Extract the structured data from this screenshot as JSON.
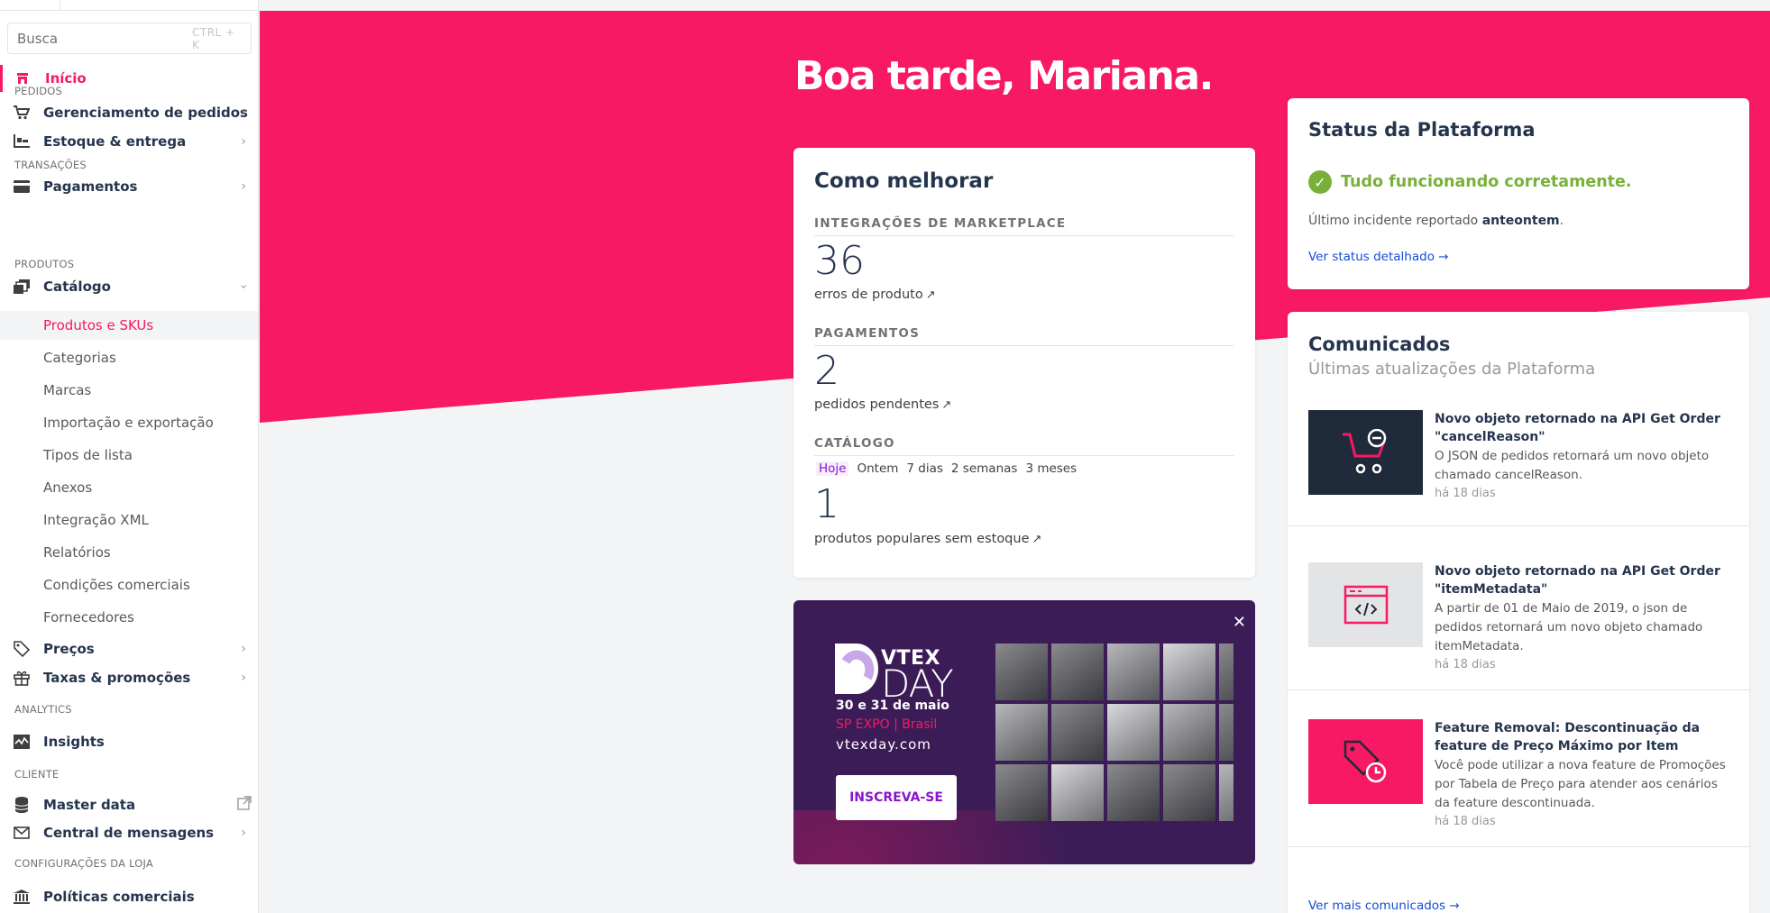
{
  "sidebar": {
    "search": {
      "placeholder": "Busca",
      "shortcut": "CTRL + K"
    },
    "home": "Início",
    "sections": {
      "pedidos": "PEDIDOS",
      "transacoes": "TRANSAÇÕES",
      "produtos": "PRODUTOS",
      "analytics": "ANALYTICS",
      "cliente": "CLIENTE",
      "config": "CONFIGURAÇÕES DA LOJA"
    },
    "items": {
      "gerenciamento": "Gerenciamento de pedidos",
      "estoque": "Estoque & entrega",
      "pagamentos": "Pagamentos",
      "catalogo": "Catálogo",
      "precos": "Preços",
      "taxas": "Taxas & promoções",
      "insights": "Insights",
      "masterdata": "Master data",
      "central": "Central de mensagens",
      "politicas": "Políticas comerciais"
    },
    "catalog_sub": [
      "Produtos e SKUs",
      "Categorias",
      "Marcas",
      "Importação e exportação",
      "Tipos de lista",
      "Anexos",
      "Integração XML",
      "Relatórios",
      "Condições comerciais",
      "Fornecedores"
    ]
  },
  "greeting": {
    "prefix": "Boa tarde,",
    "name": "Mariana",
    "suffix": "."
  },
  "como_melhorar": {
    "title": "Como melhorar",
    "marketplace": {
      "label": "INTEGRAÇÕES DE MARKETPLACE",
      "value": "36",
      "desc": "erros de produto"
    },
    "pagamentos": {
      "label": "PAGAMENTOS",
      "value": "2",
      "desc": "pedidos pendentes"
    },
    "catalogo": {
      "label": "CATÁLOGO",
      "periods": [
        "Hoje",
        "Ontem",
        "7 dias",
        "2 semanas",
        "3 meses"
      ],
      "value": "1",
      "desc": "produtos populares sem estoque"
    },
    "arrow": "↗"
  },
  "promo": {
    "close": "✕",
    "brand": "VTEX",
    "event": "DAY",
    "dates": "30 e 31 de maio",
    "place": "SP EXPO | Brasil",
    "site": "vtexday.com",
    "cta": "INSCREVA-SE"
  },
  "status": {
    "title": "Status da Plataforma",
    "ok": "Tudo funcionando corretamente.",
    "incident_prefix": "Último incidente reportado ",
    "incident_when": "anteontem",
    "incident_suffix": ".",
    "link": "Ver status detalhado →"
  },
  "comunicados": {
    "title": "Comunicados",
    "subtitle": "Últimas atualizações da Plataforma",
    "items": [
      {
        "title": "Novo objeto retornado na API Get Order \"cancelReason\"",
        "body": "O JSON de pedidos retornará um novo objeto chamado cancelReason.",
        "age": "há 18 dias",
        "icon": "cart-remove-icon"
      },
      {
        "title": "Novo objeto retornado na API Get Order \"itemMetadata\"",
        "body": "A partir de 01 de Maio de 2019, o json de pedidos retornará um novo objeto chamado itemMetadata.",
        "age": "há 18 dias",
        "icon": "code-window-icon"
      },
      {
        "title": "Feature Removal: Descontinuação da feature de Preço Máximo por Item",
        "body": "Você pode utilizar a nova feature de Promoções por Tabela de Preço para atender aos cenários da feature descontinuada.",
        "age": "há 18 dias",
        "icon": "price-tag-clock-icon"
      }
    ],
    "more": "Ver mais comunicados →"
  },
  "colors": {
    "accent": "#f71963",
    "ok": "#79b03a",
    "link": "#134cd8",
    "purple": "#8914cc",
    "promo_bg": "#3c1c57"
  }
}
